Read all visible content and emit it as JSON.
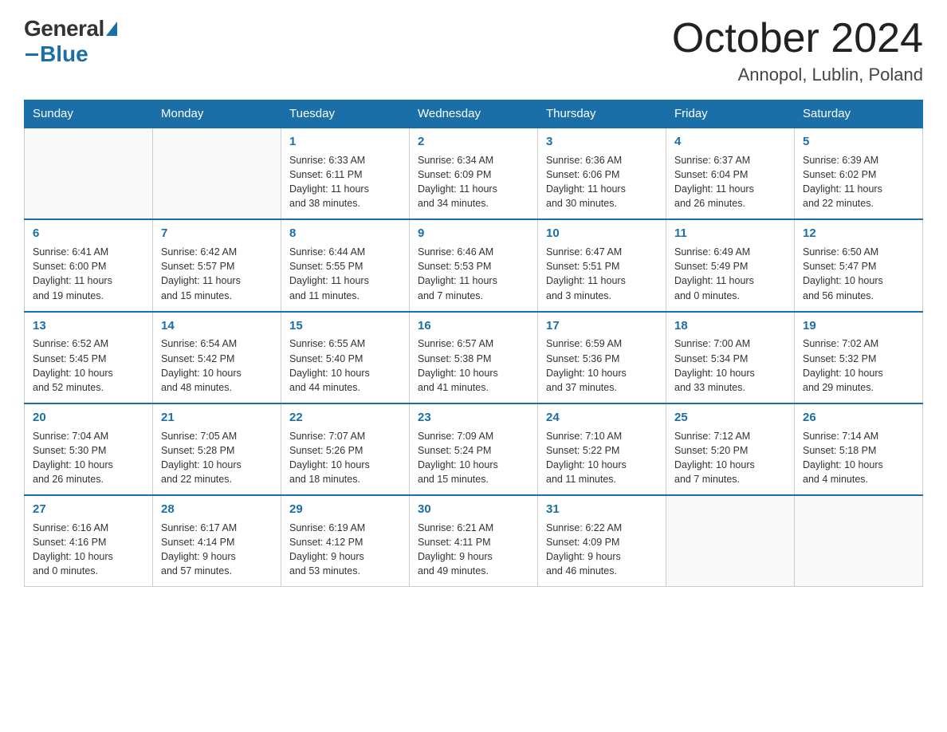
{
  "header": {
    "logo": {
      "general": "General",
      "blue": "Blue"
    },
    "title": "October 2024",
    "location": "Annopol, Lublin, Poland"
  },
  "weekdays": [
    "Sunday",
    "Monday",
    "Tuesday",
    "Wednesday",
    "Thursday",
    "Friday",
    "Saturday"
  ],
  "weeks": [
    [
      {
        "day": "",
        "info": ""
      },
      {
        "day": "",
        "info": ""
      },
      {
        "day": "1",
        "info": "Sunrise: 6:33 AM\nSunset: 6:11 PM\nDaylight: 11 hours\nand 38 minutes."
      },
      {
        "day": "2",
        "info": "Sunrise: 6:34 AM\nSunset: 6:09 PM\nDaylight: 11 hours\nand 34 minutes."
      },
      {
        "day": "3",
        "info": "Sunrise: 6:36 AM\nSunset: 6:06 PM\nDaylight: 11 hours\nand 30 minutes."
      },
      {
        "day": "4",
        "info": "Sunrise: 6:37 AM\nSunset: 6:04 PM\nDaylight: 11 hours\nand 26 minutes."
      },
      {
        "day": "5",
        "info": "Sunrise: 6:39 AM\nSunset: 6:02 PM\nDaylight: 11 hours\nand 22 minutes."
      }
    ],
    [
      {
        "day": "6",
        "info": "Sunrise: 6:41 AM\nSunset: 6:00 PM\nDaylight: 11 hours\nand 19 minutes."
      },
      {
        "day": "7",
        "info": "Sunrise: 6:42 AM\nSunset: 5:57 PM\nDaylight: 11 hours\nand 15 minutes."
      },
      {
        "day": "8",
        "info": "Sunrise: 6:44 AM\nSunset: 5:55 PM\nDaylight: 11 hours\nand 11 minutes."
      },
      {
        "day": "9",
        "info": "Sunrise: 6:46 AM\nSunset: 5:53 PM\nDaylight: 11 hours\nand 7 minutes."
      },
      {
        "day": "10",
        "info": "Sunrise: 6:47 AM\nSunset: 5:51 PM\nDaylight: 11 hours\nand 3 minutes."
      },
      {
        "day": "11",
        "info": "Sunrise: 6:49 AM\nSunset: 5:49 PM\nDaylight: 11 hours\nand 0 minutes."
      },
      {
        "day": "12",
        "info": "Sunrise: 6:50 AM\nSunset: 5:47 PM\nDaylight: 10 hours\nand 56 minutes."
      }
    ],
    [
      {
        "day": "13",
        "info": "Sunrise: 6:52 AM\nSunset: 5:45 PM\nDaylight: 10 hours\nand 52 minutes."
      },
      {
        "day": "14",
        "info": "Sunrise: 6:54 AM\nSunset: 5:42 PM\nDaylight: 10 hours\nand 48 minutes."
      },
      {
        "day": "15",
        "info": "Sunrise: 6:55 AM\nSunset: 5:40 PM\nDaylight: 10 hours\nand 44 minutes."
      },
      {
        "day": "16",
        "info": "Sunrise: 6:57 AM\nSunset: 5:38 PM\nDaylight: 10 hours\nand 41 minutes."
      },
      {
        "day": "17",
        "info": "Sunrise: 6:59 AM\nSunset: 5:36 PM\nDaylight: 10 hours\nand 37 minutes."
      },
      {
        "day": "18",
        "info": "Sunrise: 7:00 AM\nSunset: 5:34 PM\nDaylight: 10 hours\nand 33 minutes."
      },
      {
        "day": "19",
        "info": "Sunrise: 7:02 AM\nSunset: 5:32 PM\nDaylight: 10 hours\nand 29 minutes."
      }
    ],
    [
      {
        "day": "20",
        "info": "Sunrise: 7:04 AM\nSunset: 5:30 PM\nDaylight: 10 hours\nand 26 minutes."
      },
      {
        "day": "21",
        "info": "Sunrise: 7:05 AM\nSunset: 5:28 PM\nDaylight: 10 hours\nand 22 minutes."
      },
      {
        "day": "22",
        "info": "Sunrise: 7:07 AM\nSunset: 5:26 PM\nDaylight: 10 hours\nand 18 minutes."
      },
      {
        "day": "23",
        "info": "Sunrise: 7:09 AM\nSunset: 5:24 PM\nDaylight: 10 hours\nand 15 minutes."
      },
      {
        "day": "24",
        "info": "Sunrise: 7:10 AM\nSunset: 5:22 PM\nDaylight: 10 hours\nand 11 minutes."
      },
      {
        "day": "25",
        "info": "Sunrise: 7:12 AM\nSunset: 5:20 PM\nDaylight: 10 hours\nand 7 minutes."
      },
      {
        "day": "26",
        "info": "Sunrise: 7:14 AM\nSunset: 5:18 PM\nDaylight: 10 hours\nand 4 minutes."
      }
    ],
    [
      {
        "day": "27",
        "info": "Sunrise: 6:16 AM\nSunset: 4:16 PM\nDaylight: 10 hours\nand 0 minutes."
      },
      {
        "day": "28",
        "info": "Sunrise: 6:17 AM\nSunset: 4:14 PM\nDaylight: 9 hours\nand 57 minutes."
      },
      {
        "day": "29",
        "info": "Sunrise: 6:19 AM\nSunset: 4:12 PM\nDaylight: 9 hours\nand 53 minutes."
      },
      {
        "day": "30",
        "info": "Sunrise: 6:21 AM\nSunset: 4:11 PM\nDaylight: 9 hours\nand 49 minutes."
      },
      {
        "day": "31",
        "info": "Sunrise: 6:22 AM\nSunset: 4:09 PM\nDaylight: 9 hours\nand 46 minutes."
      },
      {
        "day": "",
        "info": ""
      },
      {
        "day": "",
        "info": ""
      }
    ]
  ]
}
